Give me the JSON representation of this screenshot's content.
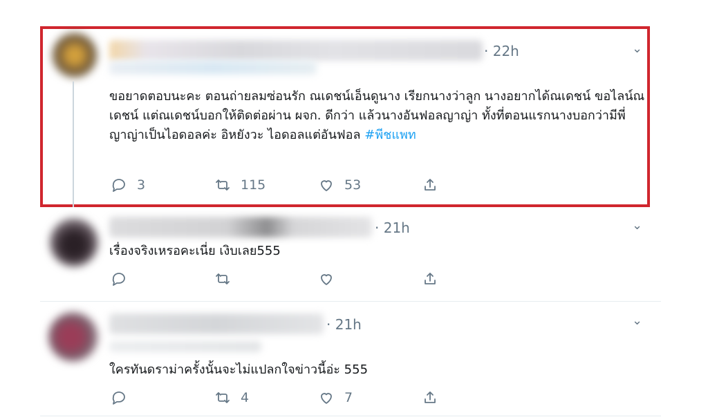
{
  "replies": [
    {
      "time": "· 22h",
      "text": "ขอยาดตอบนะคะ ตอนถ่ายลมซ่อนรัก ณเดชน์เอ็นดูนาง เรียกนางว่าลูก นางอยากได้ณเดชน์ ขอไลน์ณเดชน์ แต่ณเดชน์บอกให้ติดต่อผ่าน ผจก. ดีกว่า แล้วนางอันฟอลญาญ่า ทั้งที่ตอนแรกนางบอกว่ามีพี่ญาญ่าเป็นไอดอลค่ะ อิหยังวะ ไอดอลแต่อันฟอล",
      "hashtag": "#พีชแพท",
      "reply_count": "3",
      "retweet_count": "115",
      "like_count": "53"
    },
    {
      "time": "· 21h",
      "text": "เรื่องจริงเหรอคะเนี่ย เงิบเลย555",
      "reply_count": "",
      "retweet_count": "",
      "like_count": ""
    },
    {
      "time": "· 21h",
      "text": "ใครทันดราม่าครั้งนั้นจะไม่แปลกใจข่าวนี้อ่ะ 555",
      "reply_count": "",
      "retweet_count": "4",
      "like_count": "7"
    }
  ],
  "icons": {
    "reply": "reply-icon",
    "retweet": "retweet-icon",
    "like": "heart-icon",
    "share": "share-icon",
    "more": "chevron-down-icon"
  },
  "colors": {
    "highlight": "#d0262e",
    "hashtag": "#1da1f2",
    "muted": "#657786"
  }
}
